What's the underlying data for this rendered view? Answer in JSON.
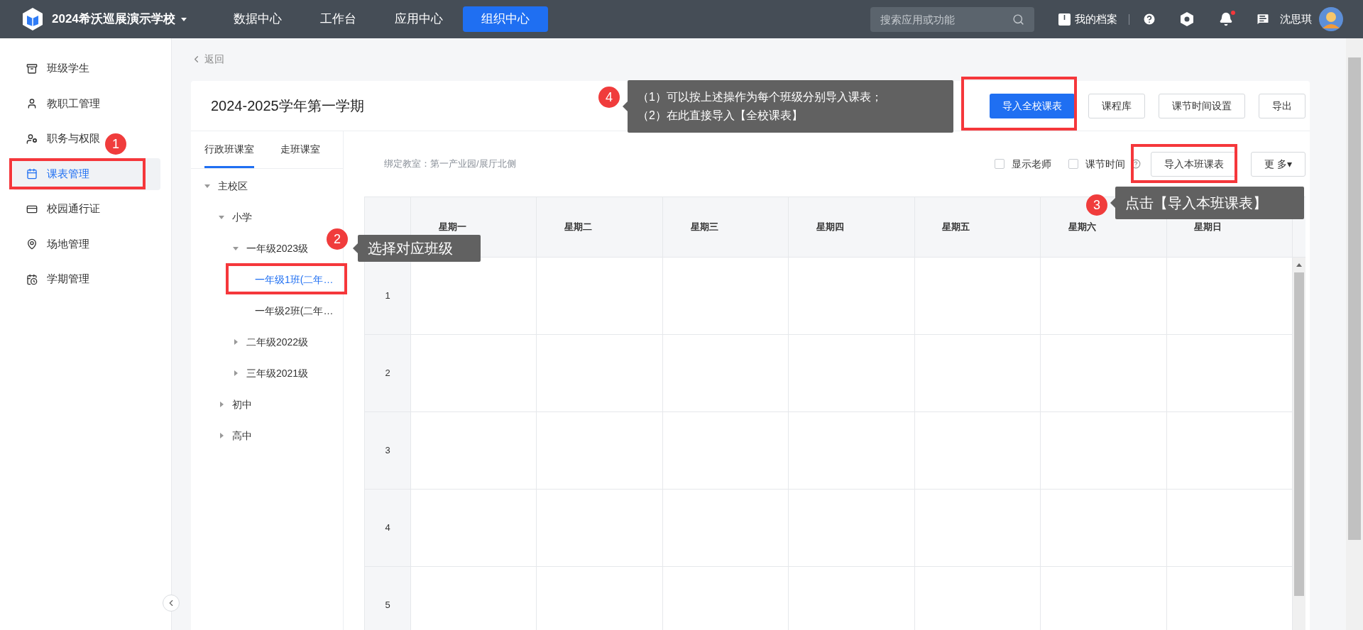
{
  "top_nav": {
    "school": "2024希沃巡展演示学校",
    "tabs": [
      {
        "label": "数据中心",
        "selected": false
      },
      {
        "label": "工作台",
        "selected": false
      },
      {
        "label": "应用中心",
        "selected": false
      },
      {
        "label": "组织中心",
        "selected": true
      }
    ],
    "search": {
      "placeholder": "搜索应用或功能"
    },
    "profile_link": "我的档案",
    "has_unread": true,
    "user": "沈思琪"
  },
  "sidebar": {
    "items": [
      {
        "label": "班级学生",
        "selected": false
      },
      {
        "label": "教职工管理",
        "selected": false
      },
      {
        "label": "职务与权限",
        "selected": false
      },
      {
        "label": "课表管理",
        "selected": true
      },
      {
        "label": "校园通行证",
        "selected": false
      },
      {
        "label": "场地管理",
        "selected": false
      },
      {
        "label": "学期管理",
        "selected": false
      }
    ]
  },
  "back_link": "返回",
  "term": {
    "title": "2024-2025学年第一学期",
    "buttons": [
      {
        "label": "导入全校课表",
        "kind": "primary"
      },
      {
        "label": "课程库",
        "kind": "default"
      },
      {
        "label": "课节时间设置",
        "kind": "default"
      },
      {
        "label": "导出",
        "kind": "default"
      }
    ]
  },
  "room_tabs": [
    {
      "label": "行政班课室",
      "selected": true
    },
    {
      "label": "走班课室",
      "selected": false
    }
  ],
  "tree": [
    {
      "label": "主校区",
      "expanded": true,
      "children": [
        {
          "label": "小学",
          "expanded": true,
          "children": [
            {
              "label": "一年级2023级",
              "expanded": true,
              "children": [
                {
                  "label": "一年级1班(二年…",
                  "selected": true
                },
                {
                  "label": "一年级2班(二年…",
                  "selected": false
                }
              ]
            },
            {
              "label": "二年级2022级",
              "expanded": false
            },
            {
              "label": "三年级2021级",
              "expanded": false
            }
          ]
        },
        {
          "label": "初中",
          "expanded": false
        },
        {
          "label": "高中",
          "expanded": false
        }
      ]
    }
  ],
  "bound_classroom": "绑定教室：第一产业园/展厅北侧",
  "options": [
    {
      "label": "显示老师",
      "checked": false,
      "help": false
    },
    {
      "label": "课节时间",
      "checked": false,
      "help": true
    }
  ],
  "actions": [
    "导入本班课表",
    "更 多▾"
  ],
  "timetable": {
    "columns": [
      "星期一",
      "星期二",
      "星期三",
      "星期四",
      "星期五",
      "星期六",
      "星期日"
    ],
    "rows": [
      "1",
      "2",
      "3",
      "4",
      "5"
    ]
  },
  "annotations": [
    {
      "number": "1"
    },
    {
      "number": "2",
      "callout": [
        "选择对应班级"
      ]
    },
    {
      "number": "3",
      "callout": [
        "点击【导入本班课表】"
      ]
    },
    {
      "number": "4",
      "callout": [
        "（1）可以按上述操作为每个班级分别导入课表；",
        "（2）在此直接导入【全校课表】"
      ]
    }
  ]
}
